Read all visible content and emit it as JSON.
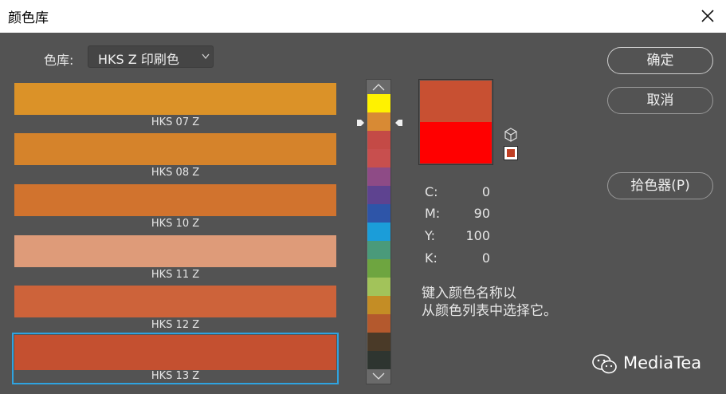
{
  "window": {
    "title": "颜色库"
  },
  "library": {
    "label": "色库:",
    "selected": "HKS Z 印刷色"
  },
  "swatches": [
    {
      "name": "HKS 07 Z",
      "color": "#DB9228"
    },
    {
      "name": "HKS 08 Z",
      "color": "#D5832B"
    },
    {
      "name": "HKS 10 Z",
      "color": "#D1732E"
    },
    {
      "name": "HKS 11 Z",
      "color": "#DE9B79"
    },
    {
      "name": "HKS 12 Z",
      "color": "#CD633A"
    },
    {
      "name": "HKS 13 Z",
      "color": "#C45030",
      "selected": true
    }
  ],
  "spectrum_strip": [
    "#FFF200",
    "#D88A34",
    "#C44A46",
    "#C84F4E",
    "#8E4B86",
    "#5E4390",
    "#2E55A8",
    "#1B9DD9",
    "#4A9A7A",
    "#6EA540",
    "#A2C35A",
    "#C48D25",
    "#B4592D",
    "#4A3A28",
    "#2E3530"
  ],
  "preview": {
    "new_color": "#C85032",
    "old_color": "#FF0000"
  },
  "websafe_color": "#C04025",
  "cmyk": [
    {
      "label": "C:",
      "value": "0"
    },
    {
      "label": "M:",
      "value": "90"
    },
    {
      "label": "Y:",
      "value": "100"
    },
    {
      "label": "K:",
      "value": "0"
    }
  ],
  "hint": {
    "line1": "键入颜色名称以",
    "line2": "从颜色列表中选择它。"
  },
  "buttons": {
    "ok": "确定",
    "cancel": "取消",
    "picker": "拾色器(P)"
  },
  "watermark": {
    "text": "MediaTea"
  },
  "colors": {
    "selection_border": "#2FA3E0",
    "background": "#535353"
  }
}
